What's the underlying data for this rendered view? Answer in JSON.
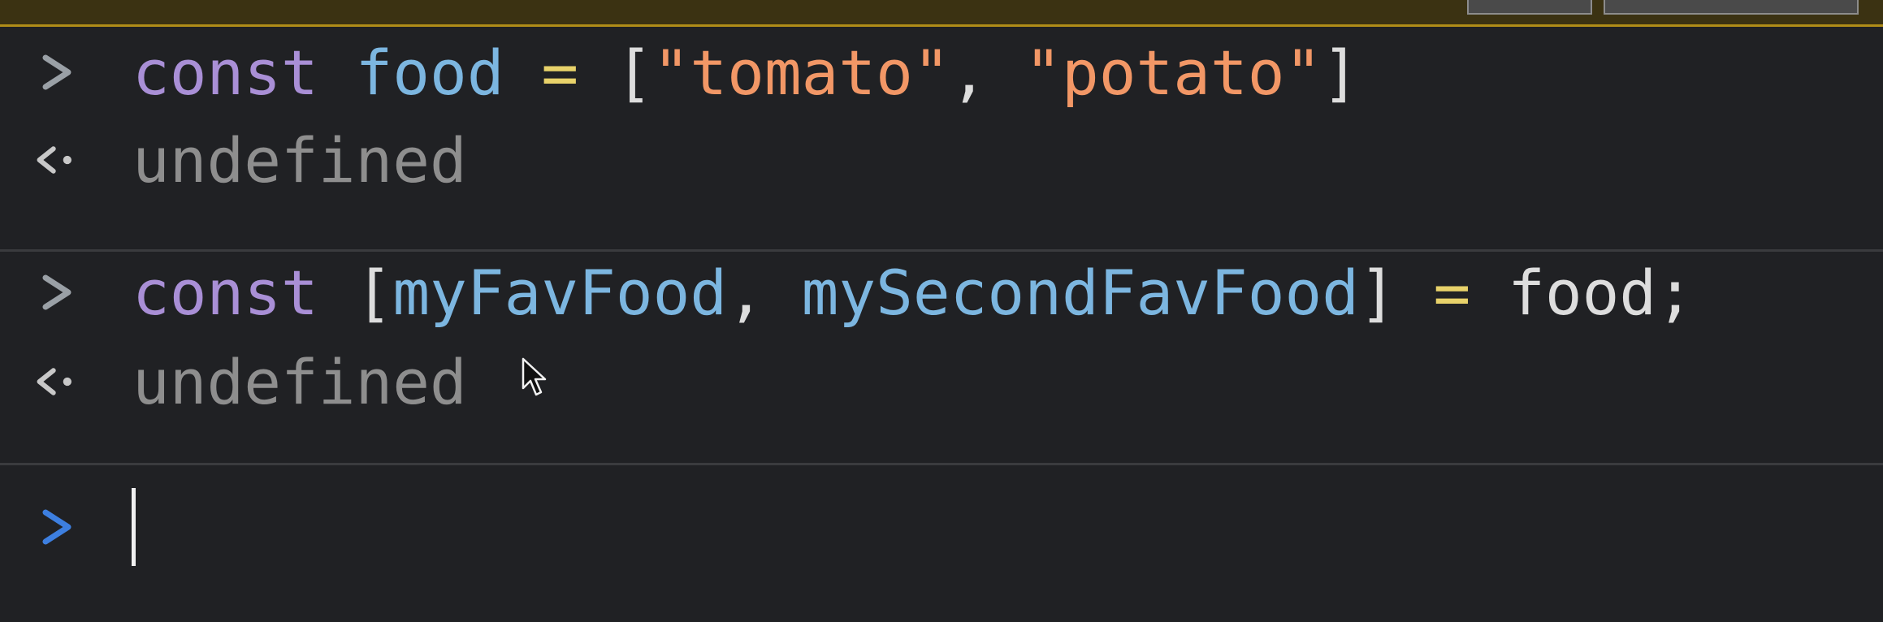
{
  "console": {
    "entries": [
      {
        "input": {
          "keyword": "const",
          "name": "food",
          "equals": "=",
          "open_bracket": "[",
          "str1": "\"tomato\"",
          "comma": ",",
          "str2": "\"potato\"",
          "close_bracket": "]"
        },
        "result": "undefined"
      },
      {
        "input": {
          "keyword": "const",
          "open_bracket": "[",
          "name1": "myFavFood",
          "comma": ",",
          "name2": "mySecondFavFood",
          "close_bracket": "]",
          "equals": "=",
          "source": "food;"
        },
        "result": "undefined"
      }
    ]
  },
  "icons": {
    "input_prompt": "chevron-right-icon",
    "result_prompt": "return-arrow-icon",
    "active_prompt": "chevron-right-icon",
    "mouse_cursor": "mouse-pointer-icon"
  },
  "colors": {
    "background": "#202124",
    "keyword": "#a98fd6",
    "variable": "#7cb6e0",
    "operator": "#e8d26a",
    "string": "#f29766",
    "result": "#8e8e8e",
    "active_prompt": "#3d7fe0",
    "divider": "#3a3b3e"
  }
}
